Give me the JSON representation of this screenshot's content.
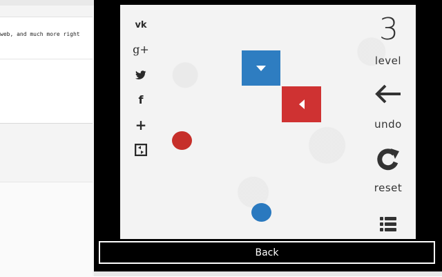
{
  "background_page": {
    "snippet": "web, and much more right"
  },
  "game": {
    "level_number": "3",
    "level_label": "level",
    "undo_label": "undo",
    "reset_label": "reset",
    "social_icons": [
      "vk-icon",
      "google-plus-icon",
      "twitter-icon",
      "facebook-icon",
      "plus-icon",
      "refresh-share-icon"
    ],
    "social_glyphs": {
      "vk": "vk",
      "gplus": "g+",
      "facebook": "f",
      "plus": "+"
    },
    "colors": {
      "blue": "#2e7dc1",
      "red": "#cf3232",
      "board": "#f3f3f3"
    }
  },
  "back_button": {
    "label": "Back"
  }
}
